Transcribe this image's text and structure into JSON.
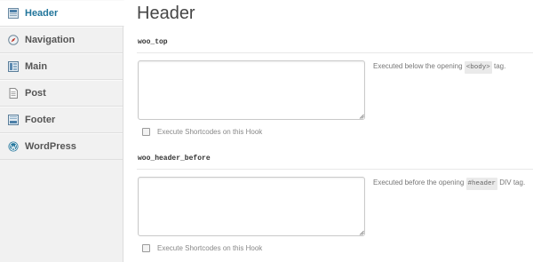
{
  "sidebar": {
    "items": [
      {
        "label": "Header",
        "icon": "header-icon",
        "active": true
      },
      {
        "label": "Navigation",
        "icon": "compass-icon",
        "active": false
      },
      {
        "label": "Main",
        "icon": "main-layout-icon",
        "active": false
      },
      {
        "label": "Post",
        "icon": "post-icon",
        "active": false
      },
      {
        "label": "Footer",
        "icon": "footer-icon",
        "active": false
      },
      {
        "label": "WordPress",
        "icon": "wordpress-icon",
        "active": false
      }
    ]
  },
  "main": {
    "title": "Header",
    "hooks": [
      {
        "name": "woo_top",
        "value": "",
        "desc_before": "Executed below the opening ",
        "desc_code": "<body>",
        "desc_after": " tag.",
        "checkbox_label": "Execute Shortcodes on this Hook",
        "checked": false
      },
      {
        "name": "woo_header_before",
        "value": "",
        "desc_before": "Executed before the opening ",
        "desc_code": "#header",
        "desc_after": " DIV tag.",
        "checkbox_label": "Execute Shortcodes on this Hook",
        "checked": false
      }
    ]
  },
  "colors": {
    "accent": "#21759b",
    "sidebar_bg": "#f1f1f1"
  }
}
